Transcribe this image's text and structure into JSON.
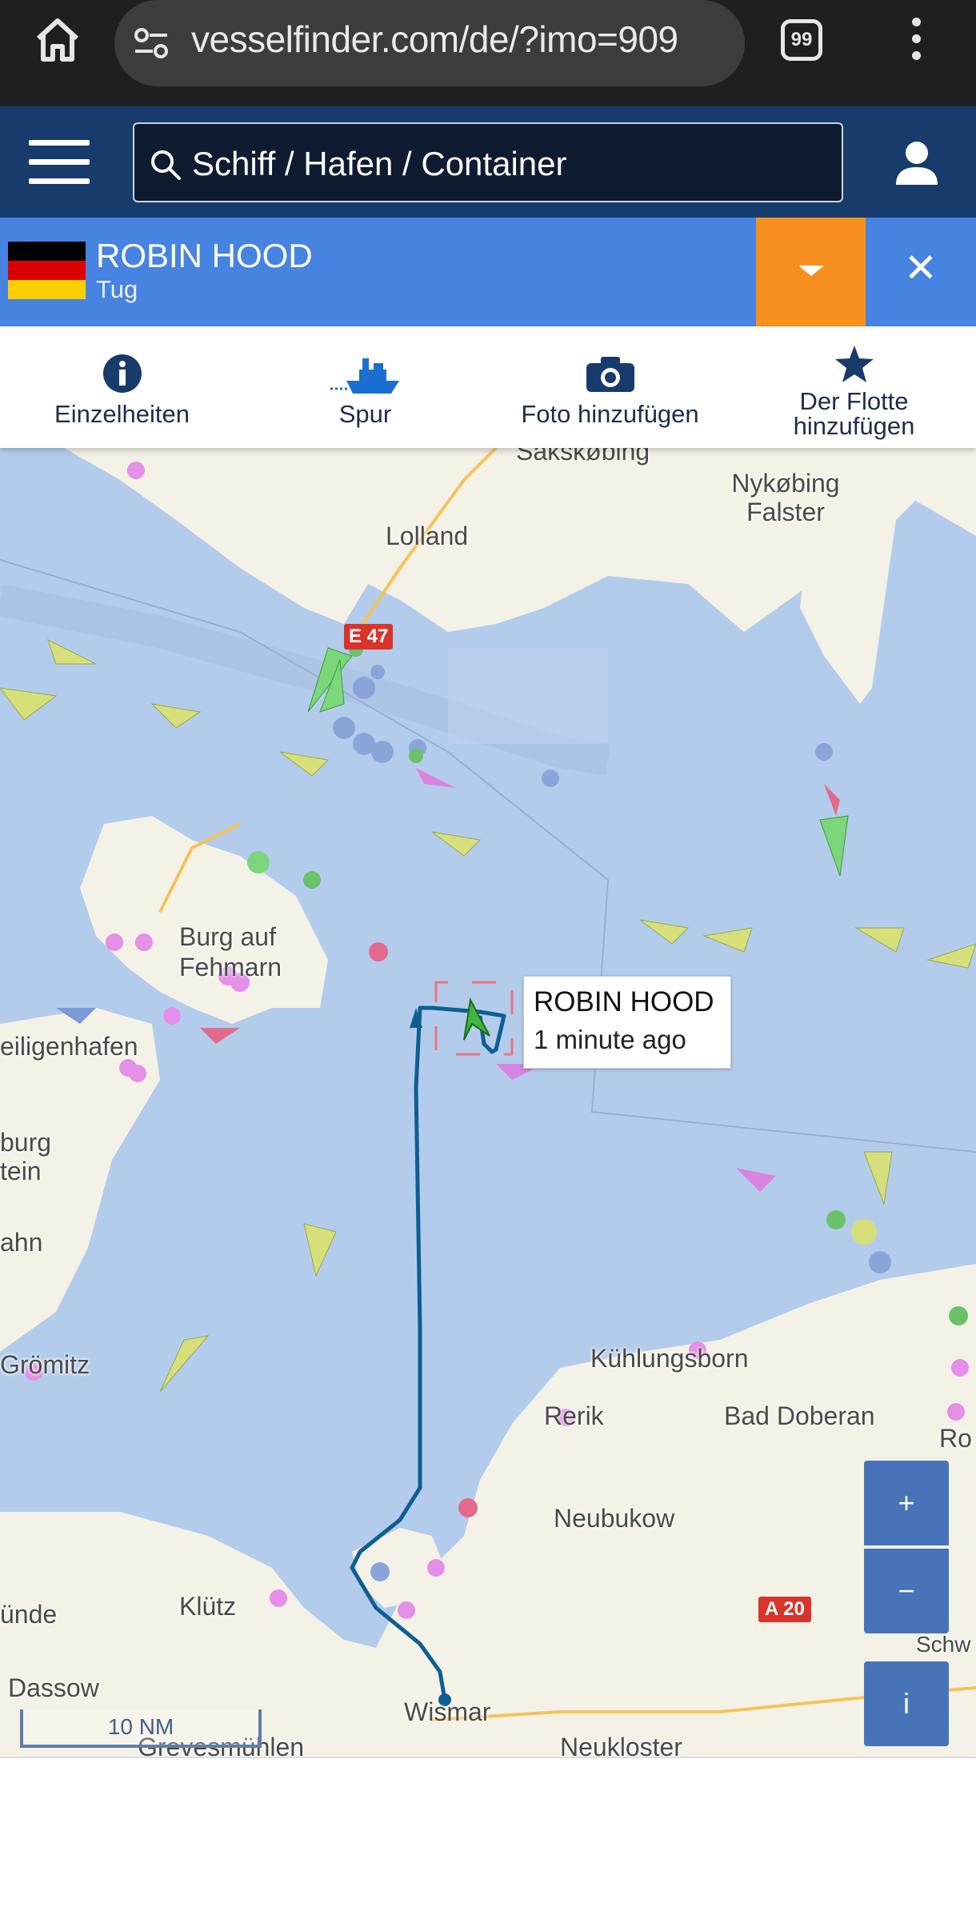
{
  "browser": {
    "url": "vesselfinder.com/de/?imo=909",
    "tab_count": "99",
    "icons": [
      "home-icon",
      "site-settings-icon",
      "tab-switcher-icon",
      "more-menu-icon"
    ]
  },
  "nav": {
    "search_placeholder": "Schiff / Hafen / Container",
    "icons": [
      "hamburger-menu-icon",
      "search-icon",
      "user-icon"
    ]
  },
  "vessel": {
    "name": "ROBIN HOOD",
    "type": "Tug",
    "flag": "Germany",
    "colors": {
      "bar": "#4783e1",
      "dropdown": "#f7901e"
    }
  },
  "actions": [
    {
      "label": "Einzelheiten",
      "icon": "info-icon"
    },
    {
      "label": "Spur",
      "icon": "ship-track-icon"
    },
    {
      "label": "Foto hinzufügen",
      "icon": "camera-icon"
    },
    {
      "label": "Der Flotte hinzufügen",
      "icon": "star-icon"
    }
  ],
  "map": {
    "places": [
      "Sakskøbing",
      "Nykøbing Falster",
      "Lolland",
      "E 47",
      "Burg auf Fehmarn",
      "eiligenhafen",
      "burg tein",
      "ahn",
      "Grömitz",
      "Kühlungsborn",
      "Rerik",
      "Bad Doberan",
      "Ro",
      "Neubukow",
      "A 20",
      "Schw",
      "ünde",
      "Klütz",
      "Dassow",
      "Wismar",
      "Grevesmühlen",
      "Neukloster"
    ],
    "popup": {
      "name": "ROBIN HOOD",
      "time": "1 minute ago"
    },
    "scale": "10 NM",
    "zoom_in": "+",
    "zoom_out": "−",
    "info": "i"
  }
}
